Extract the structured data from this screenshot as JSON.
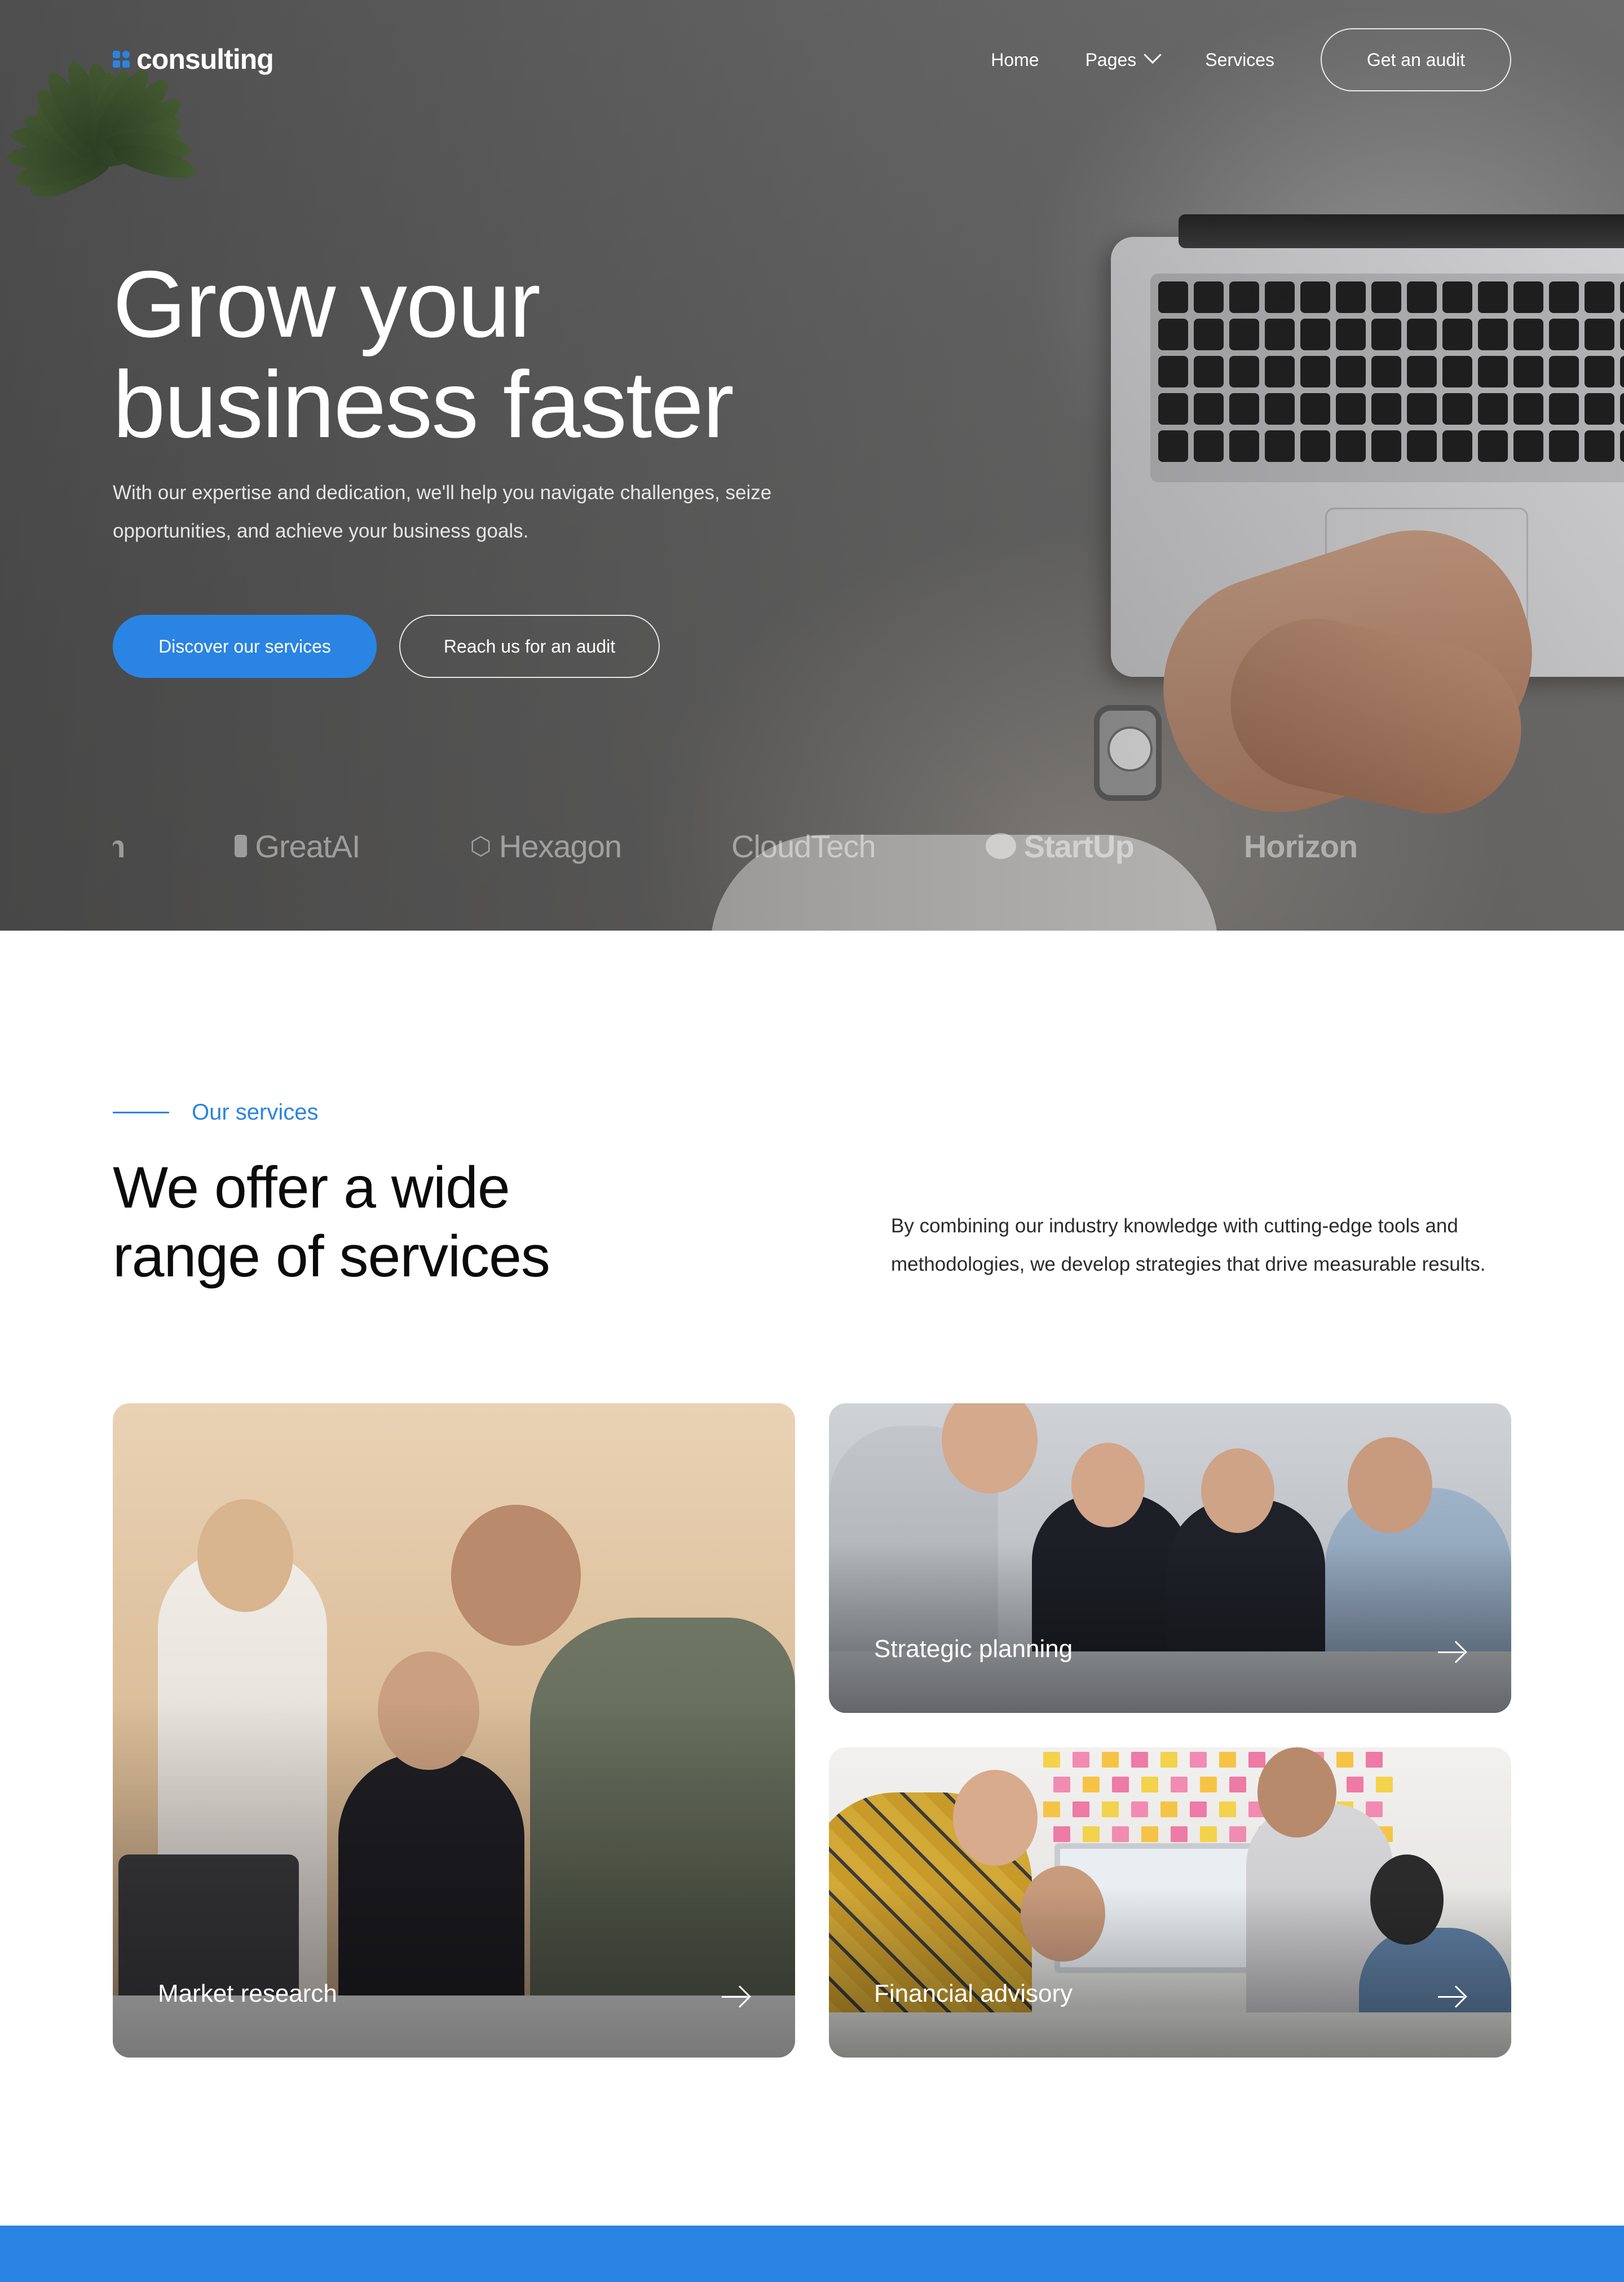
{
  "brand": {
    "name": "consulting",
    "accent": "#2a84e3"
  },
  "nav": {
    "links": [
      {
        "label": "Home"
      },
      {
        "label": "Pages"
      },
      {
        "label": "Services"
      }
    ],
    "cta": "Get an audit"
  },
  "hero": {
    "title_line1": "Grow your",
    "title_line2": "business faster",
    "subtitle": "With our expertise and dedication, we'll help you navigate challenges, seize opportunities, and achieve your business goals.",
    "primary_cta": "Discover our services",
    "secondary_cta": "Reach us for an audit"
  },
  "partners": [
    {
      "name": "Horizon",
      "icon": "none"
    },
    {
      "name": "GreatAI",
      "icon": "pill-icon"
    },
    {
      "name": "Hexagon",
      "icon": "hexagon-icon"
    },
    {
      "name": "CloudTech",
      "icon": "none"
    },
    {
      "name": "StartUp",
      "icon": "blob-icon"
    },
    {
      "name": "Horizon",
      "icon": "none"
    }
  ],
  "services": {
    "eyebrow": "Our services",
    "title_line1": "We offer a wide",
    "title_line2": "range of services",
    "description": "By combining our industry knowledge with cutting-edge tools and methodologies, we develop strategies that drive measurable results.",
    "cards": [
      {
        "label": "Market research"
      },
      {
        "label": "Strategic planning"
      },
      {
        "label": "Financial advisory"
      }
    ]
  }
}
